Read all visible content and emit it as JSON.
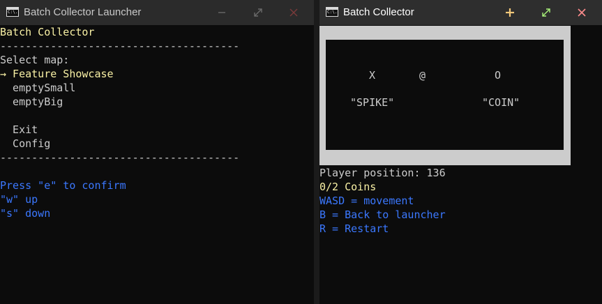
{
  "launcher": {
    "window_title": "Batch Collector Launcher",
    "icon_text": "C:\\.",
    "heading": "Batch Collector",
    "rule": "--------------------------------------",
    "select_prompt": "Select map:",
    "menu": [
      {
        "text": "→ Feature Showcase",
        "selected": true
      },
      {
        "text": "  emptySmall",
        "selected": false
      },
      {
        "text": "  emptyBig",
        "selected": false
      }
    ],
    "exit_label": "  Exit",
    "config_label": "  Config",
    "help": [
      "Press \"e\" to confirm",
      "\"w\" up",
      "\"s\" down"
    ]
  },
  "game": {
    "window_title": "Batch Collector",
    "icon_text": "C:\\.",
    "arena": {
      "spike_symbol": "X",
      "player_symbol": "@",
      "coin_symbol": "O",
      "spike_label": "\"SPIKE\"",
      "coin_label": "\"COIN\""
    },
    "player_position_text": "Player position: 136",
    "coins_text": "0/2 Coins",
    "help": [
      "WASD = movement",
      "B = Back to launcher",
      "R = Restart"
    ]
  },
  "colors": {
    "console_bg": "#0c0c0c",
    "text_white": "#cccccc",
    "text_yellow": "#f9f1a5",
    "text_blue": "#3b78ff",
    "arena_border": "#cccccc"
  }
}
